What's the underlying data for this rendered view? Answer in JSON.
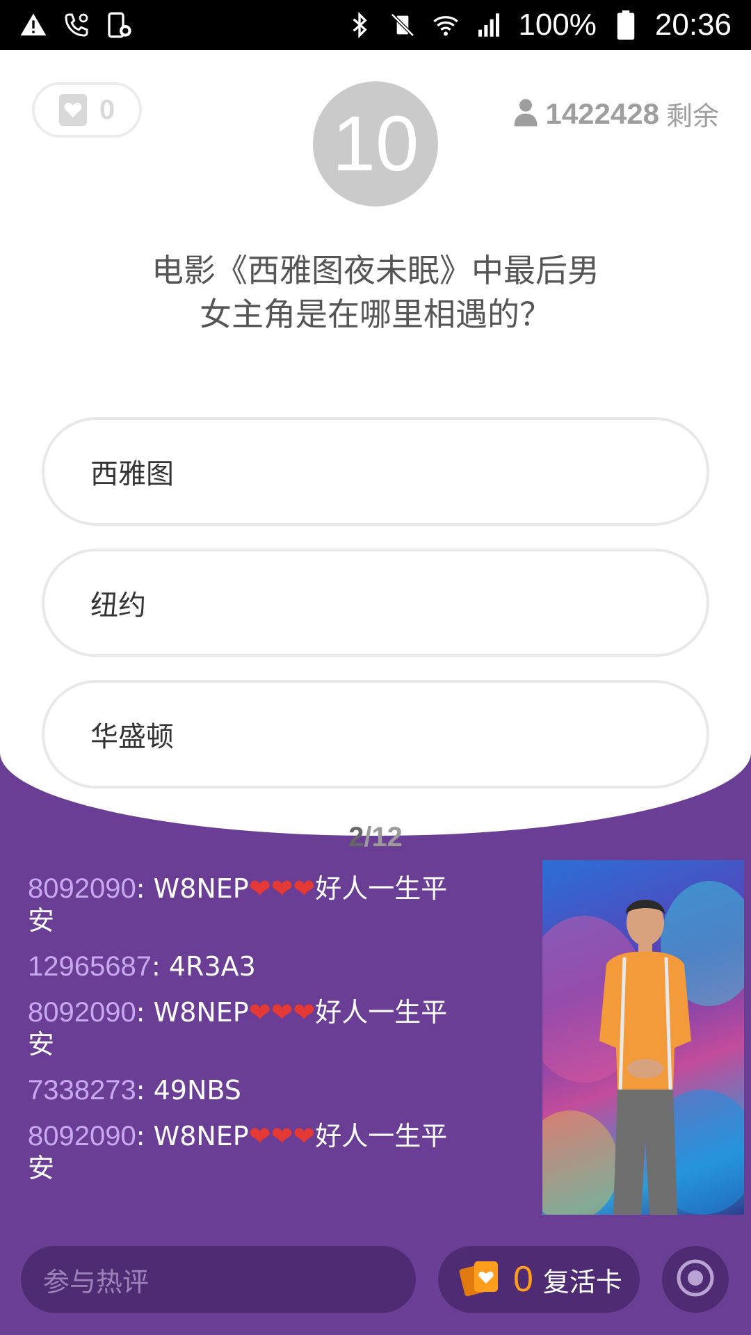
{
  "status_bar": {
    "left_icons": [
      "warning-icon",
      "wifi-call-icon",
      "screen-lock-icon"
    ],
    "right_icons": [
      "bluetooth-icon",
      "vibrate-off-icon",
      "wifi-icon",
      "signal-icon",
      "battery-icon"
    ],
    "battery": "100%",
    "time": "20:36"
  },
  "header": {
    "lives_count": "0",
    "timer": "10",
    "remaining_count": "1422428",
    "remaining_label": "剩余"
  },
  "question": {
    "text": "电影《西雅图夜未眠》中最后男女主角是在哪里相遇的？",
    "options": [
      "西雅图",
      "纽约",
      "华盛顿"
    ]
  },
  "progress": {
    "current": "2",
    "separator": "/",
    "total": "12"
  },
  "chat": {
    "messages": [
      {
        "user": "8092090",
        "sep": ": ",
        "text": "W8NEP",
        "hearts": "❤❤❤",
        "suffix": "好人一生平安"
      },
      {
        "user": "12965687",
        "sep": ": ",
        "text": "4R3A3",
        "hearts": "",
        "suffix": ""
      },
      {
        "user": "8092090",
        "sep": ": ",
        "text": "W8NEP",
        "hearts": "❤❤❤",
        "suffix": "好人一生平安"
      },
      {
        "user": "7338273",
        "sep": ": ",
        "text": "49NBS",
        "hearts": "",
        "suffix": ""
      },
      {
        "user": "8092090",
        "sep": ": ",
        "text": "W8NEP",
        "hearts": "❤❤❤",
        "suffix": "好人一生平安"
      }
    ]
  },
  "bottom_bar": {
    "comment_placeholder": "参与热评",
    "revive_count": "0",
    "revive_label": "复活卡"
  },
  "colors": {
    "background_purple": "#6b3e96",
    "accent_orange": "#ff9d1c",
    "uid_lilac": "#c9a8f2"
  }
}
